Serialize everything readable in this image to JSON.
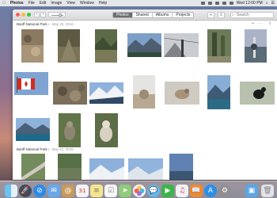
{
  "menubar": {
    "apple": "",
    "app_name": "Photos",
    "items": [
      "File",
      "Edit",
      "Image",
      "View",
      "Window",
      "Help"
    ],
    "clock": "Wed 12:00 PM"
  },
  "toolbar": {
    "tabs": [
      {
        "label": "Photos",
        "active": true
      },
      {
        "label": "Shared",
        "active": false
      },
      {
        "label": "Albums",
        "active": false
      },
      {
        "label": "Projects",
        "active": false
      }
    ],
    "search_placeholder": "Search"
  },
  "sections": [
    {
      "title": "Banff National Park",
      "date": "May 20, 2016"
    },
    {
      "title": "Banff National Park",
      "date": "May 21, 2016"
    }
  ],
  "dock_icons": [
    "finder-icon",
    "launchpad-icon",
    "safari-icon",
    "mail-icon",
    "contacts-icon",
    "calendar-icon",
    "notes-icon",
    "reminders-icon",
    "maps-icon",
    "photos-icon",
    "messages-icon",
    "facetime-icon",
    "music-icon",
    "books-icon",
    "app-store-icon",
    "system-preferences-icon",
    "downloads-folder-icon",
    "trash-icon"
  ]
}
